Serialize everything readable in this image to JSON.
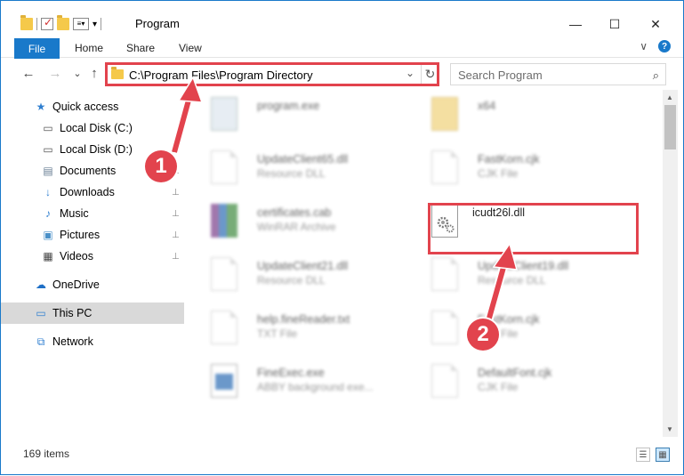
{
  "title": {
    "window_title": "Program",
    "minimize": "—",
    "maximize": "☐",
    "close": "✕"
  },
  "ribbon": {
    "tabs": [
      "File",
      "Home",
      "Share",
      "View"
    ],
    "expand": "∨",
    "help": "?"
  },
  "nav": {
    "back": "←",
    "forward": "→",
    "recent": "⌄",
    "up": "↑",
    "address": "C:\\Program Files\\Program Directory",
    "address_dropdown": "⌄",
    "refresh": "↻",
    "search_placeholder": "Search Program",
    "search_glyph": "⌕"
  },
  "sidebar": {
    "items": [
      {
        "label": "Quick access",
        "icon": "star-icon",
        "glyph": "★",
        "color": "#2f7fd0",
        "pinned": false
      },
      {
        "label": "Local Disk (C:)",
        "icon": "drive-icon",
        "glyph": "▭",
        "color": "#555555",
        "pinned": false
      },
      {
        "label": "Local Disk (D:)",
        "icon": "drive-icon",
        "glyph": "▭",
        "color": "#555555",
        "pinned": true
      },
      {
        "label": "Documents",
        "icon": "documents-icon",
        "glyph": "▤",
        "color": "#6a7f95",
        "pinned": true
      },
      {
        "label": "Downloads",
        "icon": "download-icon",
        "glyph": "↓",
        "color": "#2f7fd0",
        "pinned": true
      },
      {
        "label": "Music",
        "icon": "music-icon",
        "glyph": "♪",
        "color": "#2f7fd0",
        "pinned": true
      },
      {
        "label": "Pictures",
        "icon": "pictures-icon",
        "glyph": "▣",
        "color": "#4a90c8",
        "pinned": true
      },
      {
        "label": "Videos",
        "icon": "videos-icon",
        "glyph": "▦",
        "color": "#444444",
        "pinned": true
      },
      {
        "label": "OneDrive",
        "icon": "onedrive-icon",
        "glyph": "☁",
        "color": "#1e6fc6",
        "pinned": false
      },
      {
        "label": "This PC",
        "icon": "computer-icon",
        "glyph": "▭",
        "color": "#2f7fd0",
        "pinned": false
      },
      {
        "label": "Network",
        "icon": "network-icon",
        "glyph": "⧉",
        "color": "#2f7fd0",
        "pinned": false
      }
    ],
    "pin_glyph": "📌"
  },
  "files": [
    {
      "name": "program.exe",
      "type": "",
      "icon": "exe-icon"
    },
    {
      "name": "x64",
      "type": "",
      "icon": "folder-icon"
    },
    {
      "name": "UpdateClient65.dll",
      "type": "Resource DLL",
      "icon": "file-icon"
    },
    {
      "name": "FastKorn.cjk",
      "type": "CJK File",
      "icon": "file-icon"
    },
    {
      "name": "certificates.cab",
      "type": "WinRAR Archive",
      "icon": "archive-icon"
    },
    {
      "name": "icudt26l.dll",
      "type": "",
      "icon": "dll-gear-icon"
    },
    {
      "name": "UpdateClient21.dll",
      "type": "Resource DLL",
      "icon": "file-icon"
    },
    {
      "name": "UpdateClient19.dll",
      "type": "Resource DLL",
      "icon": "file-icon"
    },
    {
      "name": "help.fineReader.txt",
      "type": "TXT File",
      "icon": "file-icon"
    },
    {
      "name": "FastKorn.cjk",
      "type": "CJK File",
      "icon": "file-icon"
    },
    {
      "name": "FineExec.exe",
      "type": "ABBY background exe...",
      "icon": "exe-window-icon"
    },
    {
      "name": "DefaultFont.cjk",
      "type": "CJK File",
      "icon": "file-icon"
    }
  ],
  "status": {
    "item_count": "169 items"
  },
  "callouts": {
    "one": "1",
    "two": "2"
  },
  "colors": {
    "accent": "#1979ca",
    "highlight": "#e2434d"
  }
}
